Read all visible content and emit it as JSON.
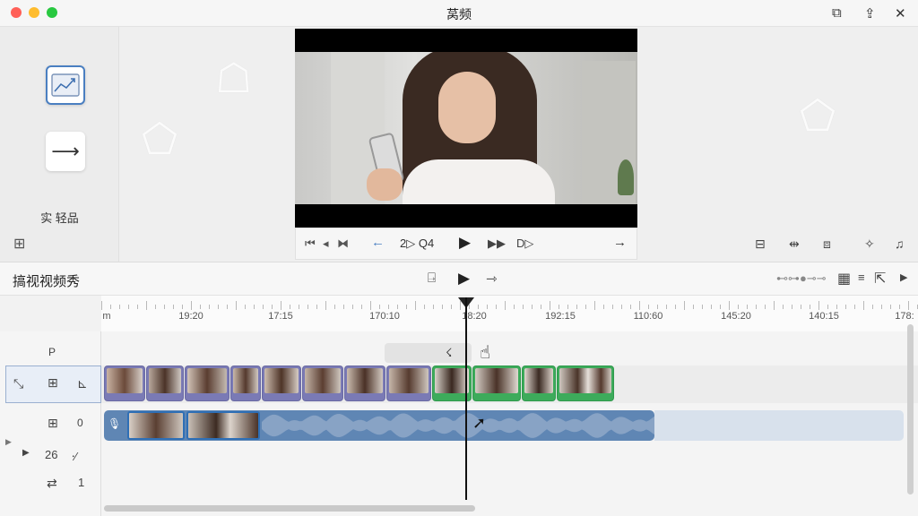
{
  "window": {
    "title": "莴频",
    "titlebar_icons": [
      "layers-icon",
      "share-icon",
      "close-icon"
    ]
  },
  "left_panel": {
    "tools": [
      {
        "name": "effects-tool",
        "icon": "image-chart-icon",
        "selected": true
      },
      {
        "name": "transition-tool",
        "icon": "arrow-right-icon",
        "glyph": "⟶"
      }
    ],
    "label": "实 轻品",
    "bottom_icon": "grid-icon"
  },
  "preview_controls": {
    "timecode": "2▷ Q4",
    "mark_in": "D▷"
  },
  "timeline": {
    "title": "搞视视频秀",
    "ruler_labels": [
      "m",
      "19:20",
      "17:15",
      "170:10",
      "18:20",
      "192:15",
      "110:60",
      "145:20",
      "140:15",
      "178:"
    ],
    "track_headers": {
      "row_label": "P",
      "video_track_icons": [
        "select-icon",
        "grid-icon",
        "crop-icon"
      ],
      "audio_track_label": "0",
      "counter_a": "26",
      "counter_b": "1"
    },
    "tooltip_label": "☇"
  },
  "colors": {
    "accent": "#4a7fc1",
    "video_clip": "#7a7ab5",
    "selected_clip": "#3dab5b",
    "audio_clip": "#5f86b4"
  }
}
